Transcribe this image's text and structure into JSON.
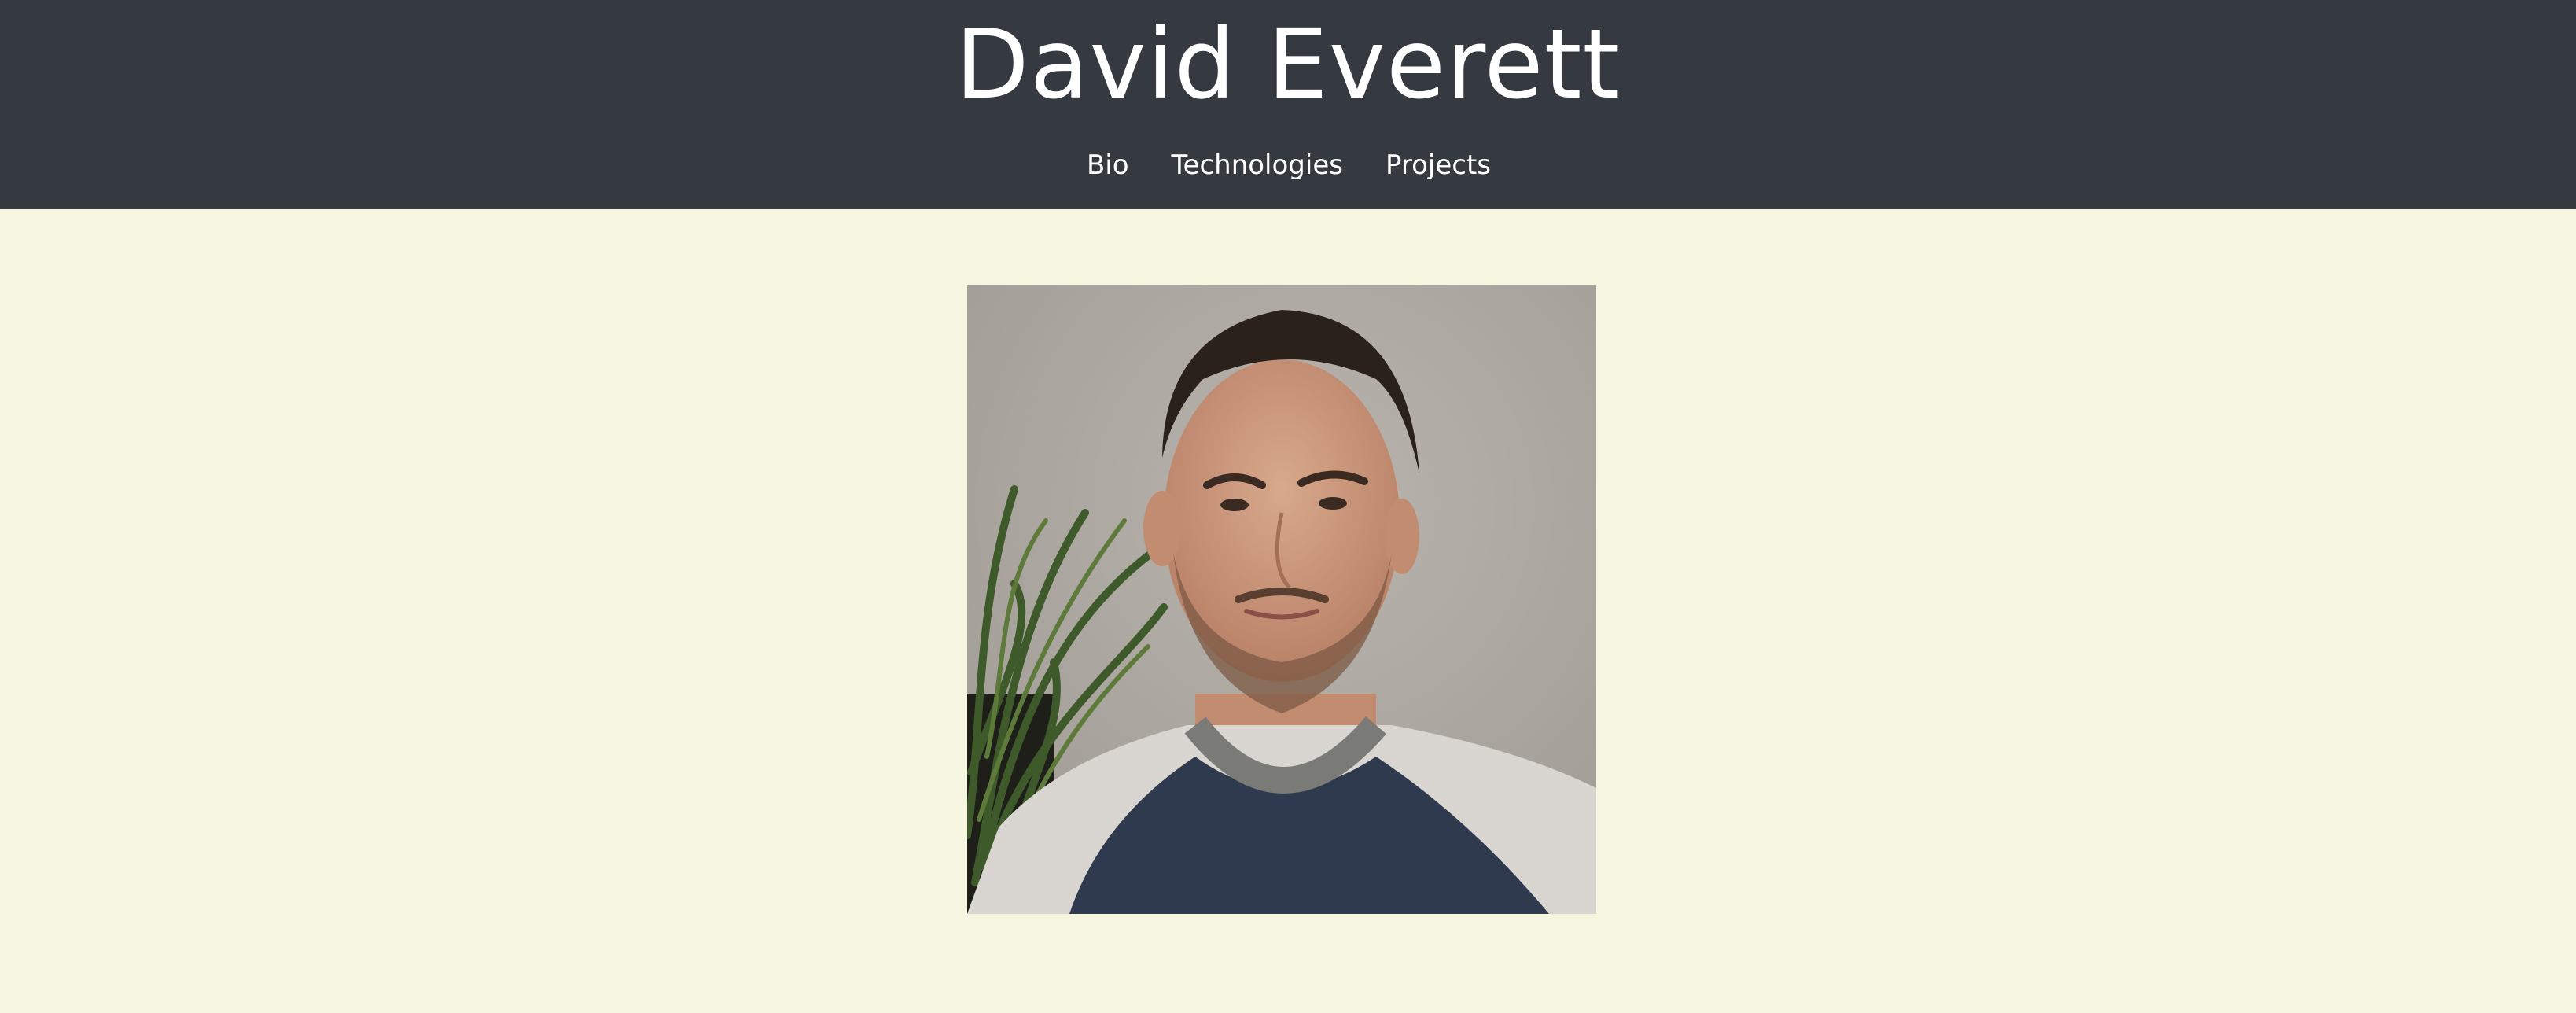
{
  "header": {
    "title": "David Everett",
    "background_color": "#353940"
  },
  "nav": {
    "items": [
      {
        "label": "Bio"
      },
      {
        "label": "Technologies"
      },
      {
        "label": "Projects"
      }
    ]
  },
  "main": {
    "background_color": "#f6f5df",
    "portrait_icon": "profile-photo"
  }
}
